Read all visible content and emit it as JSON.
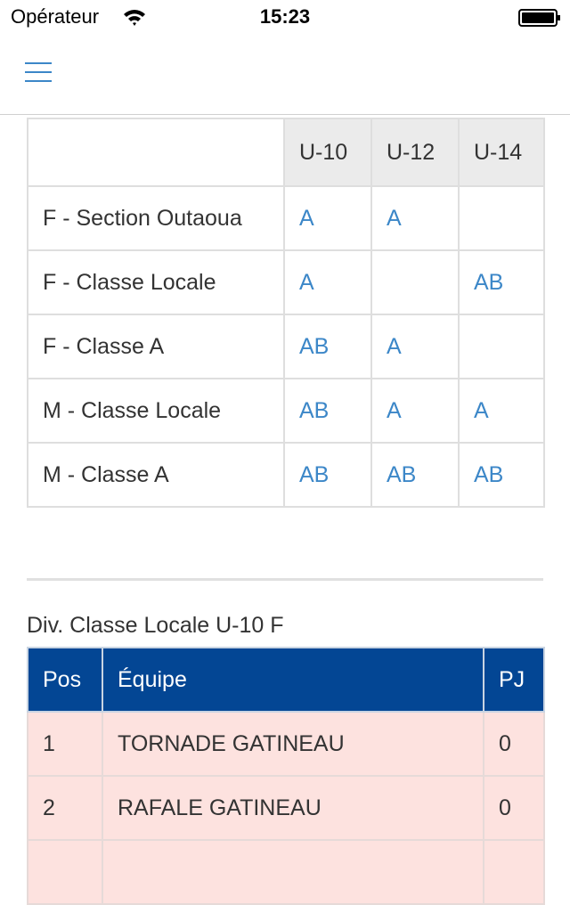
{
  "status_bar": {
    "carrier": "Opérateur",
    "time": "15:23"
  },
  "header": {
    "menu_icon": "hamburger-menu-icon",
    "accent_color": "#3c87c8"
  },
  "matrix": {
    "columns": [
      "U-10",
      "U-12",
      "U-14"
    ],
    "rows": [
      {
        "label": "F - Section Outaoua",
        "cells": [
          "A",
          "A",
          ""
        ]
      },
      {
        "label": "F - Classe Locale",
        "cells": [
          "A",
          "",
          "AB"
        ]
      },
      {
        "label": "F - Classe A",
        "cells": [
          "AB",
          "A",
          ""
        ]
      },
      {
        "label": "M - Classe Locale",
        "cells": [
          "AB",
          "A",
          "A"
        ]
      },
      {
        "label": "M - Classe A",
        "cells": [
          "AB",
          "AB",
          "AB"
        ]
      }
    ]
  },
  "standings": {
    "caption": "Div. Classe Locale U-10 F",
    "header_color": "#034694",
    "row_color": "#fde2df",
    "headers": {
      "pos": "Pos",
      "team": "Équipe",
      "gp": "PJ"
    },
    "rows": [
      {
        "pos": "1",
        "team": "TORNADE GATINEAU",
        "gp": "0"
      },
      {
        "pos": "2",
        "team": "RAFALE GATINEAU",
        "gp": "0"
      },
      {
        "pos": "",
        "team": "",
        "gp": ""
      }
    ]
  }
}
